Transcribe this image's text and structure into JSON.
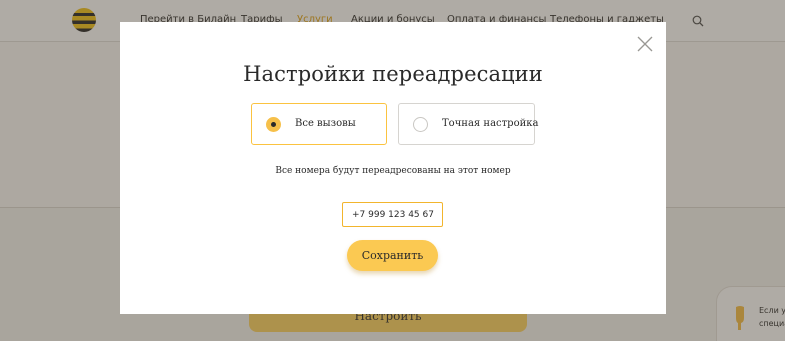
{
  "background": {
    "nav": [
      "Перейти в Билайн",
      "Тарифы",
      "Услуги",
      "Акции и бонусы",
      "Оплата и финансы",
      "Телефоны и гаджеты"
    ],
    "configure_label": "Настроить",
    "help_text_line1": "Если у",
    "help_text_line2": "специа"
  },
  "modal": {
    "title": "Настройки переадресации",
    "options": [
      {
        "label": "Все вызовы",
        "selected": true
      },
      {
        "label": "Точная настройка",
        "selected": false
      }
    ],
    "hint": "Все номера будут переадресованы на этот номер",
    "phone_value": "+7 999 123 45 67",
    "save_label": "Сохранить"
  },
  "colors": {
    "accent": "#fbc952",
    "accent_border": "#f2b52d",
    "overlay": "rgba(65,55,40,0.42)"
  },
  "icons": [
    "beeline-logo",
    "search-icon",
    "close-icon",
    "radio-selected",
    "radio-unselected",
    "help-hand-icon"
  ]
}
